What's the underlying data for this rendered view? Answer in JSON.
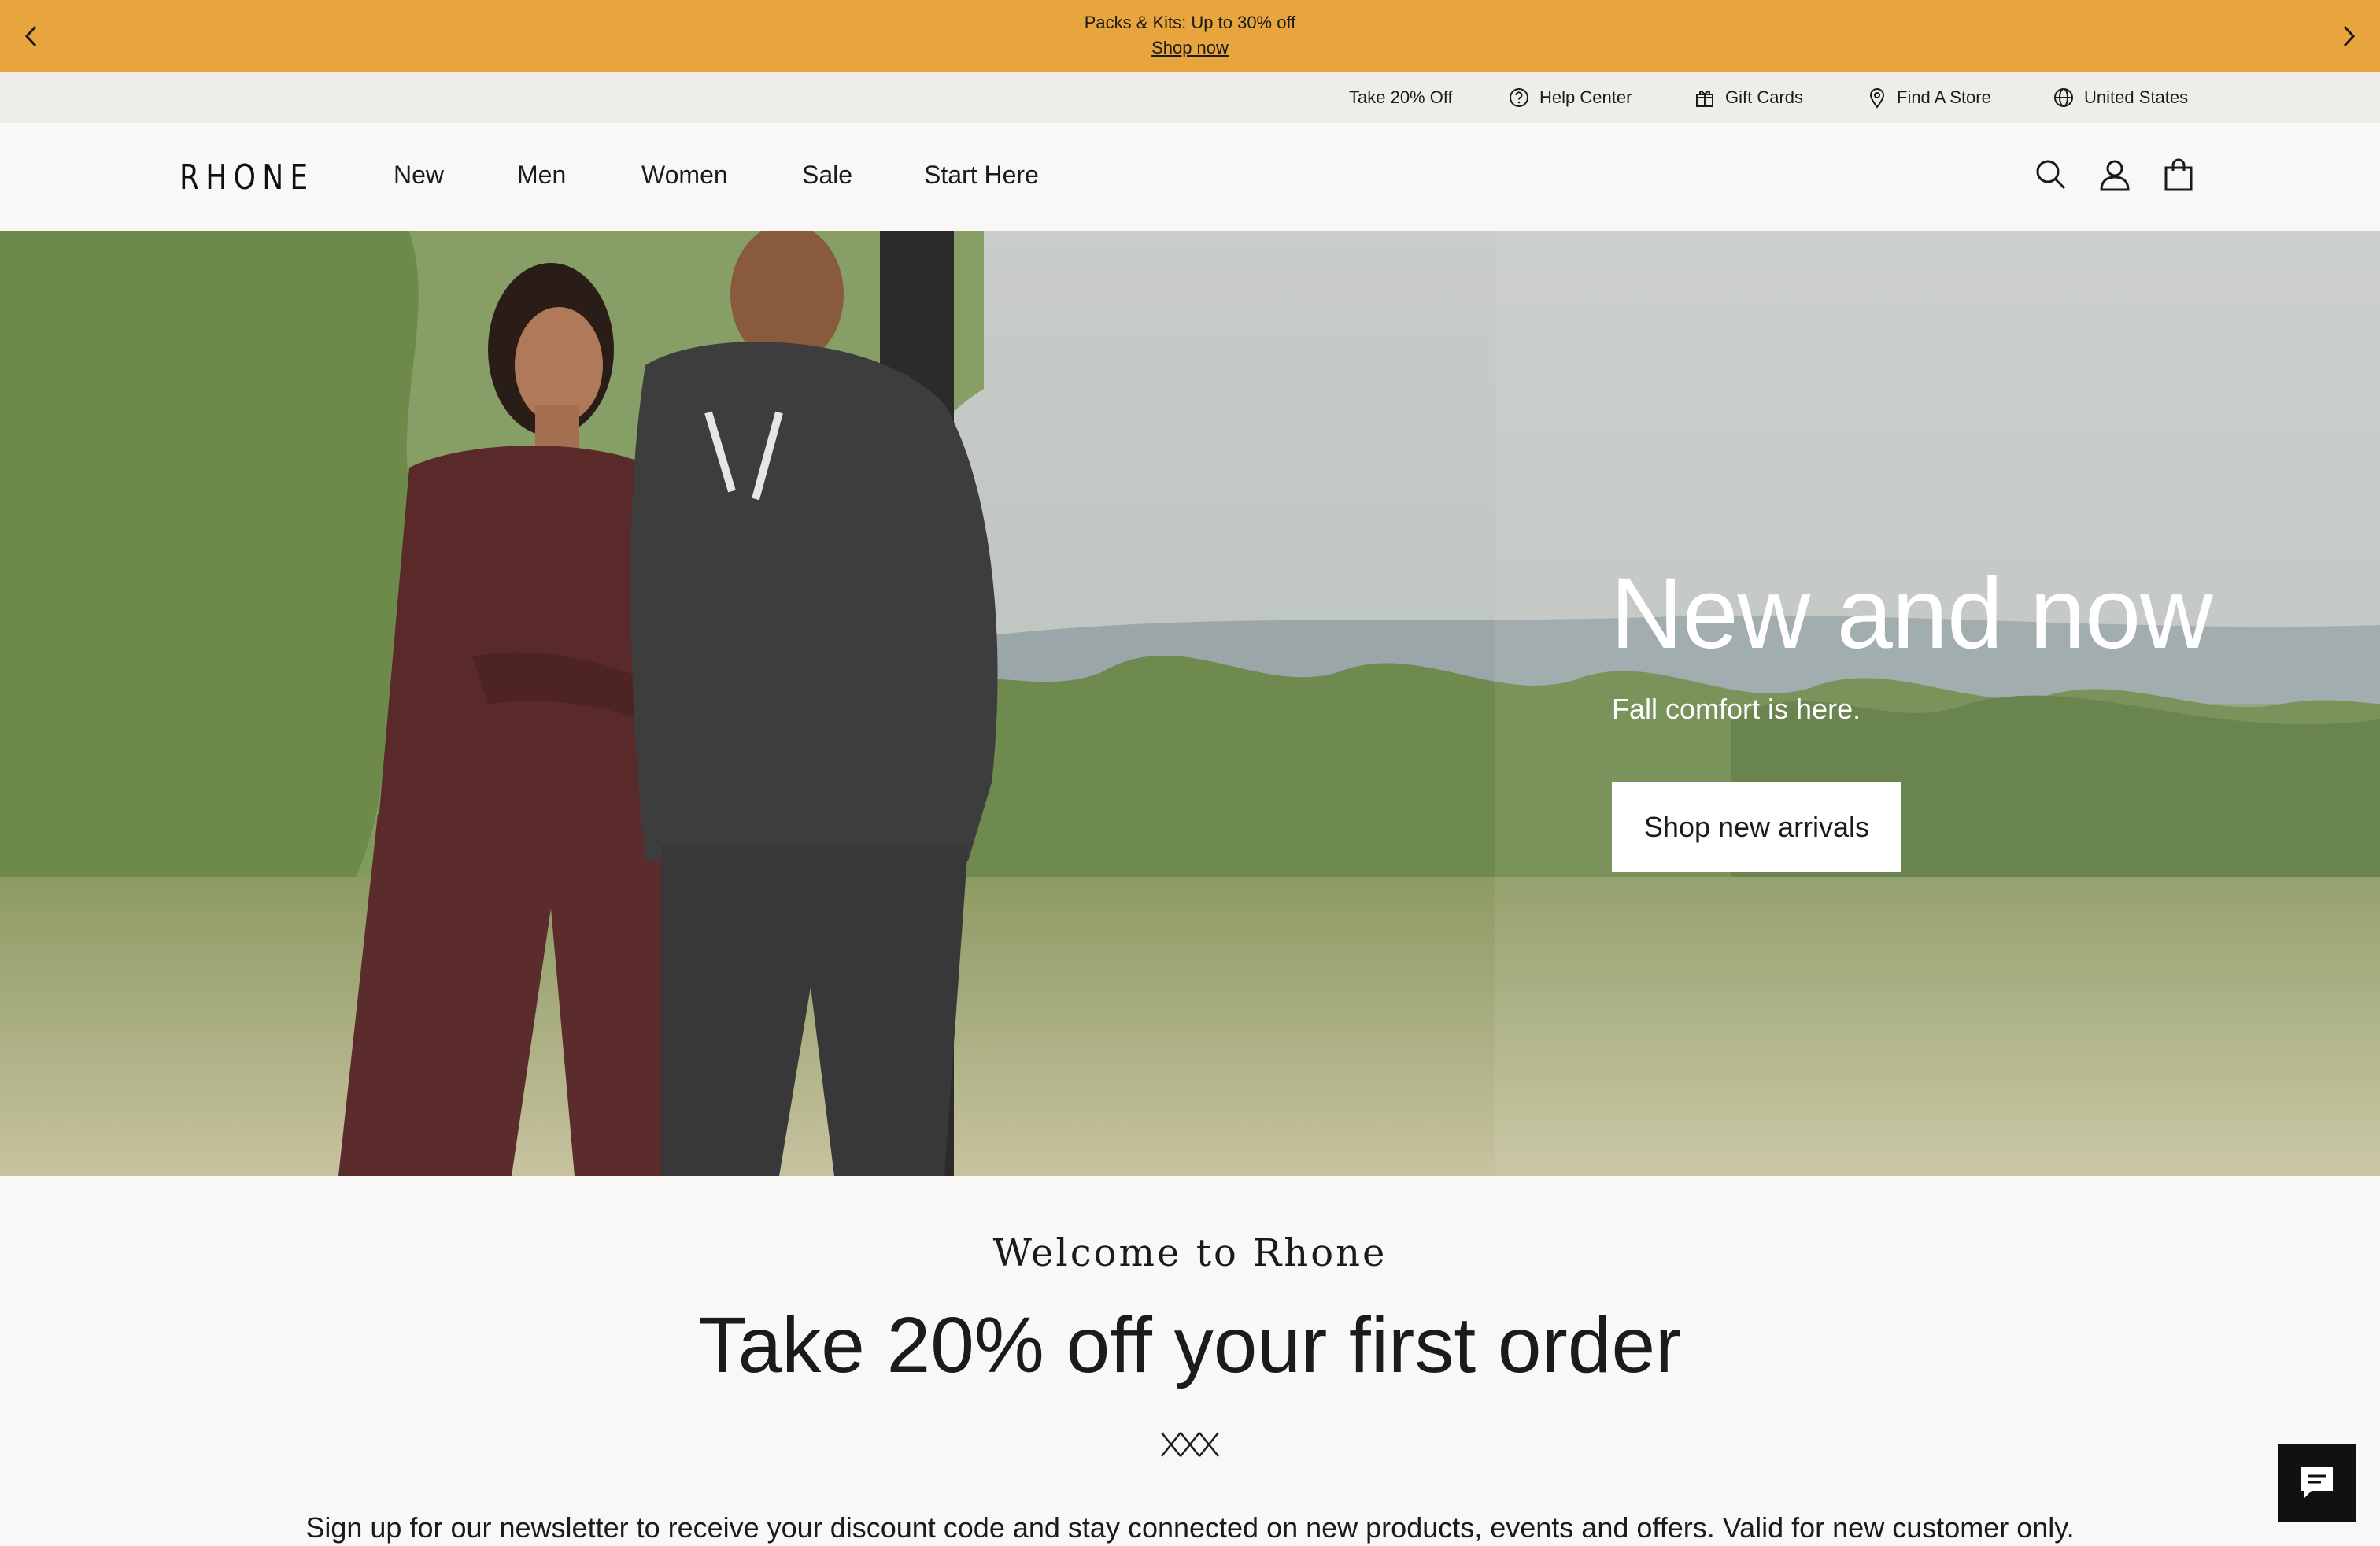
{
  "promo": {
    "message": "Packs & Kits: Up to 30% off",
    "link": "Shop now",
    "prev_icon": "chevron-left-icon",
    "next_icon": "chevron-right-icon",
    "background": "#e8a43d"
  },
  "utility_bar": {
    "items": [
      {
        "label": "Take 20% Off",
        "icon": ""
      },
      {
        "label": "Help Center",
        "icon": "help-circle-icon"
      },
      {
        "label": "Gift Cards",
        "icon": "gift-icon"
      },
      {
        "label": "Find A Store",
        "icon": "map-pin-icon"
      },
      {
        "label": "United States",
        "icon": "globe-icon"
      }
    ]
  },
  "nav": {
    "logo": "RHONE",
    "links": [
      "New",
      "Men",
      "Women",
      "Sale",
      "Start Here"
    ],
    "icons": [
      "search-icon",
      "account-icon",
      "cart-icon"
    ]
  },
  "hero": {
    "title": "New and now",
    "subtitle": "Fall comfort is here.",
    "cta": "Shop new arrivals"
  },
  "newsletter": {
    "eyebrow": "Welcome to Rhone",
    "headline": "Take 20% off your first order",
    "body": "Sign up for our newsletter to receive your discount code and stay connected on new products, events and offers. Valid for new customer only."
  },
  "chat": {
    "icon": "chat-icon"
  }
}
